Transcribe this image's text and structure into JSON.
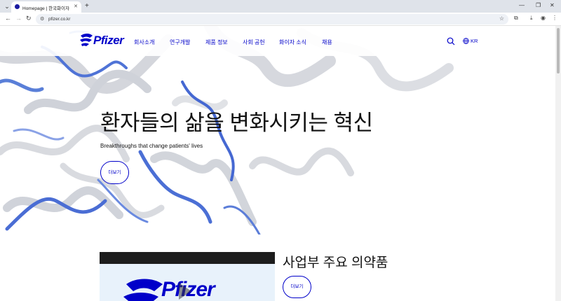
{
  "browser": {
    "tab_title": "Homepage | 한국화이자",
    "new_tab": "+",
    "url": "pfizer.co.kr",
    "window_controls": [
      "⌄",
      "—",
      "❐",
      "✕"
    ]
  },
  "header": {
    "logo_text": "Pfizer",
    "nav": [
      "회사소개",
      "연구개발",
      "제품 정보",
      "사회 공헌",
      "화이자 소식",
      "채용"
    ],
    "lang_label": "KR"
  },
  "hero": {
    "title": "환자들의 삶을 변화시키는 혁신",
    "subtitle": "Breakthroughs that change patients' lives",
    "button_label": "더보기"
  },
  "section": {
    "title": "사업부 주요 의약품",
    "button_label": "더보기",
    "video_logo_text": "Pfizer"
  },
  "colors": {
    "brand_blue": "#0000c9",
    "chrome_bg": "#dfe3ea"
  }
}
